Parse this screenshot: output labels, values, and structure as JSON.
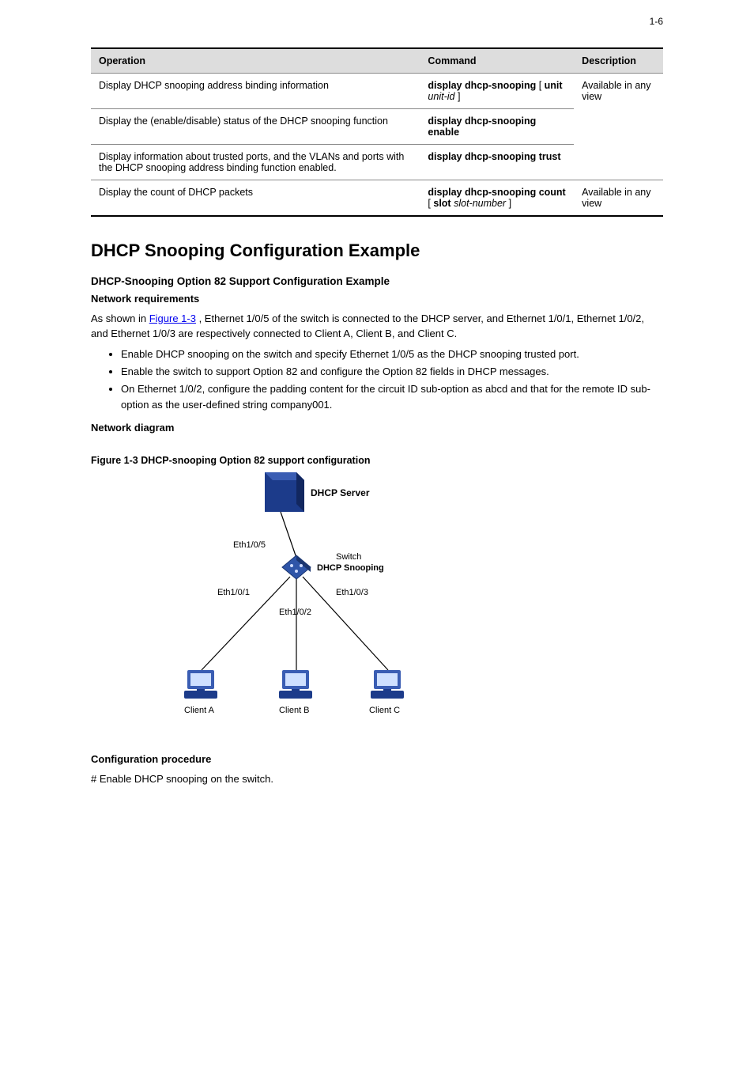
{
  "page_number": "1-6",
  "table": {
    "headers": [
      "Operation",
      "Command",
      "Description"
    ],
    "rows": [
      {
        "op": "Display DHCP snooping address binding information",
        "cmd_parts": [
          {
            "t": "display dhcp-snooping",
            "b": true
          },
          {
            "t": " [ ",
            "b": false
          },
          {
            "t": "unit",
            "b": true
          },
          {
            "t": " ",
            "b": false
          },
          {
            "t": "unit-id",
            "i": true
          },
          {
            "t": " ]",
            "b": false
          }
        ]
      },
      {
        "op": "Display the (enable/disable) status of the DHCP snooping function",
        "cmd_parts": [
          {
            "t": "display dhcp-snooping enable",
            "b": true
          }
        ]
      },
      {
        "op": "Display information about trusted ports, and the VLANs and ports with the DHCP snooping address binding function enabled.",
        "cmd_parts": [
          {
            "t": "display dhcp-snooping trust",
            "b": true
          }
        ]
      },
      {
        "op": "Display the count of DHCP packets",
        "cmd_parts": [
          {
            "t": "display dhcp-snooping count ",
            "b": true
          },
          {
            "t": "[ ",
            "b": false
          },
          {
            "t": "slot",
            "b": true
          },
          {
            "t": " ",
            "b": false
          },
          {
            "t": "slot-number",
            "i": true
          },
          {
            "t": " ]",
            "b": false
          }
        ]
      }
    ],
    "desc_top": "Available in any view",
    "desc_bot": "Available in any view"
  },
  "section_title": "DHCP Snooping Configuration Example",
  "sub1": "DHCP-Snooping Option 82 Support Configuration Example",
  "net_req_title": "Network requirements",
  "net_req_text_prefix": "As shown in ",
  "net_req_link": "Figure 1-3",
  "net_req_text_suffix": ", Ethernet 1/0/5 of the switch is connected to the DHCP server, and Ethernet 1/0/1, Ethernet 1/0/2, and Ethernet 1/0/3 are respectively connected to Client A, Client B, and Client C.",
  "bullets": [
    "Enable DHCP snooping on the switch and specify Ethernet 1/0/5 as the DHCP snooping trusted port.",
    "Enable the switch to support Option 82 and configure the Option 82 fields in DHCP messages.",
    "On Ethernet 1/0/2, configure the padding content for the circuit ID sub-option as abcd and that for the remote ID sub-option as the user-defined string company001."
  ],
  "net_diag_title": "Network diagram",
  "fig_caption": "Figure 1-3 DHCP-snooping Option 82 support configuration",
  "diagram": {
    "dhcp_server": "DHCP Server",
    "switch_top": "Switch",
    "switch_bot": "DHCP Snooping",
    "eth5": "Eth1/0/5",
    "eth1": "Eth1/0/1",
    "eth2": "Eth1/0/2",
    "eth3": "Eth1/0/3",
    "clientA": "Client A",
    "clientB": "Client B",
    "clientC": "Client C"
  },
  "proc_title": "Configuration procedure",
  "proc_step": "# Enable DHCP snooping on the switch."
}
